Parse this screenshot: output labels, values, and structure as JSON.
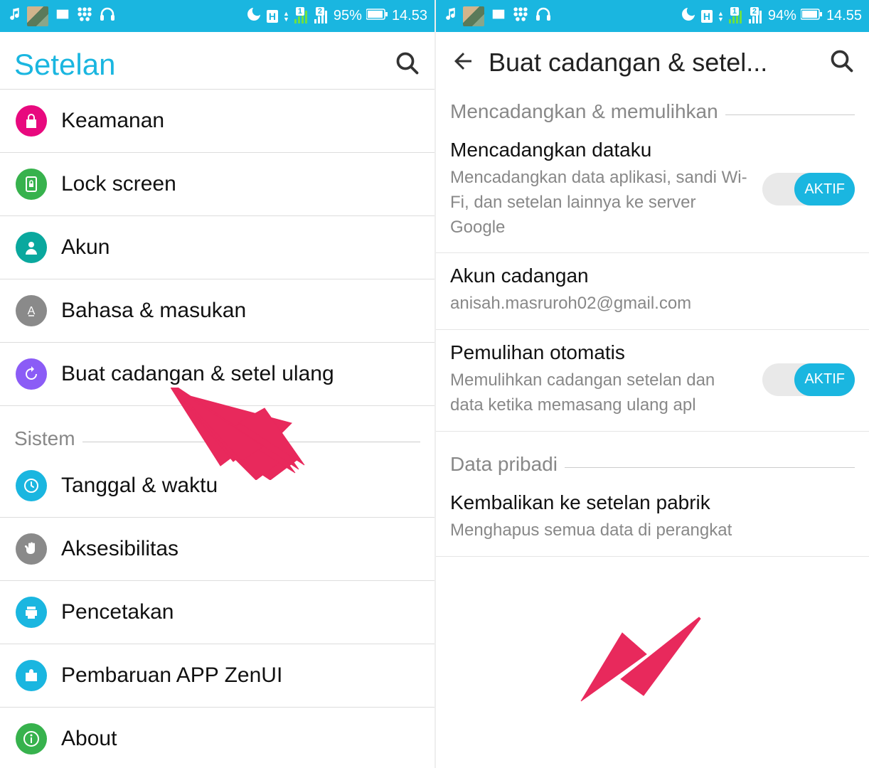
{
  "left": {
    "status": {
      "battery": "95%",
      "time": "14.53",
      "h": "H"
    },
    "title": "Setelan",
    "rows": [
      {
        "label": "Keamanan",
        "color": "#E8097E",
        "icon": "lock"
      },
      {
        "label": "Lock screen",
        "color": "#37B24D",
        "icon": "lockscreen"
      },
      {
        "label": "Akun",
        "color": "#0AA89E",
        "icon": "person"
      },
      {
        "label": "Bahasa & masukan",
        "color": "#8A8A8A",
        "icon": "a"
      },
      {
        "label": "Buat cadangan & setel ulang",
        "color": "#8B5CF6",
        "icon": "restore"
      }
    ],
    "section": "Sistem",
    "rows2": [
      {
        "label": "Tanggal & waktu",
        "color": "#1AB6E0",
        "icon": "clock"
      },
      {
        "label": "Aksesibilitas",
        "color": "#8A8A8A",
        "icon": "hand"
      },
      {
        "label": "Pencetakan",
        "color": "#1AB6E0",
        "icon": "print"
      },
      {
        "label": "Pembaruan APP ZenUI",
        "color": "#1AB6E0",
        "icon": "bag"
      },
      {
        "label": "About",
        "color": "#37B24D",
        "icon": "info"
      }
    ]
  },
  "right": {
    "status": {
      "battery": "94%",
      "time": "14.55",
      "h": "H"
    },
    "title": "Buat cadangan & setel...",
    "section1": "Mencadangkan & memulihkan",
    "items": [
      {
        "title": "Mencadangkan dataku",
        "sub": "Mencadangkan data aplikasi, sandi Wi-Fi, dan setelan lainnya ke server Google",
        "toggle": "AKTIF"
      },
      {
        "title": "Akun cadangan",
        "sub": "anisah.masruroh02@gmail.com"
      },
      {
        "title": "Pemulihan otomatis",
        "sub": "Memulihkan cadangan setelan dan data ketika memasang ulang apl",
        "toggle": "AKTIF"
      }
    ],
    "section2": "Data pribadi",
    "items2": [
      {
        "title": "Kembalikan ke setelan pabrik",
        "sub": "Menghapus semua data di perangkat"
      }
    ]
  }
}
